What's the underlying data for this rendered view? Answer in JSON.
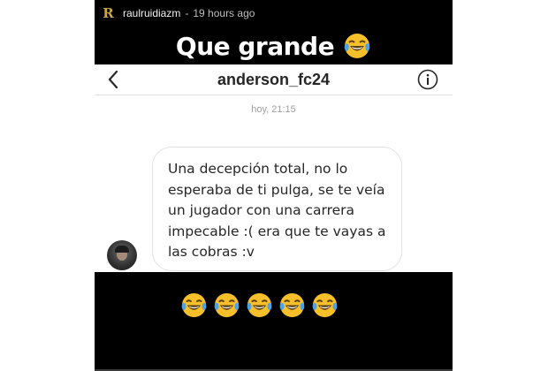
{
  "story": {
    "username": "raulruidiazm",
    "separator": "-",
    "time": "19 hours ago",
    "caption": "Que grande",
    "caption_emoji": "face-with-tears-of-joy-emoji",
    "reaction_emojis": [
      "face-with-tears-of-joy-emoji",
      "face-with-tears-of-joy-emoji",
      "face-with-tears-of-joy-emoji",
      "face-with-tears-of-joy-emoji",
      "face-with-tears-of-joy-emoji"
    ]
  },
  "screenshot": {
    "thread_title": "anderson_fc24",
    "timestamp": "hoy, 21:15",
    "message": "Una decepción total, no lo esperaba de ti pulga, se te veía un jugador con una carrera impecable :( era que te vayas a las cobras :v",
    "back_icon": "chevron-left-icon",
    "info_icon": "info-icon"
  },
  "colors": {
    "story_background": "#000000",
    "emoji_yellow": "#f7c02b",
    "tear_blue": "#4aa3e8",
    "logo_gold": "#c9a64e"
  }
}
